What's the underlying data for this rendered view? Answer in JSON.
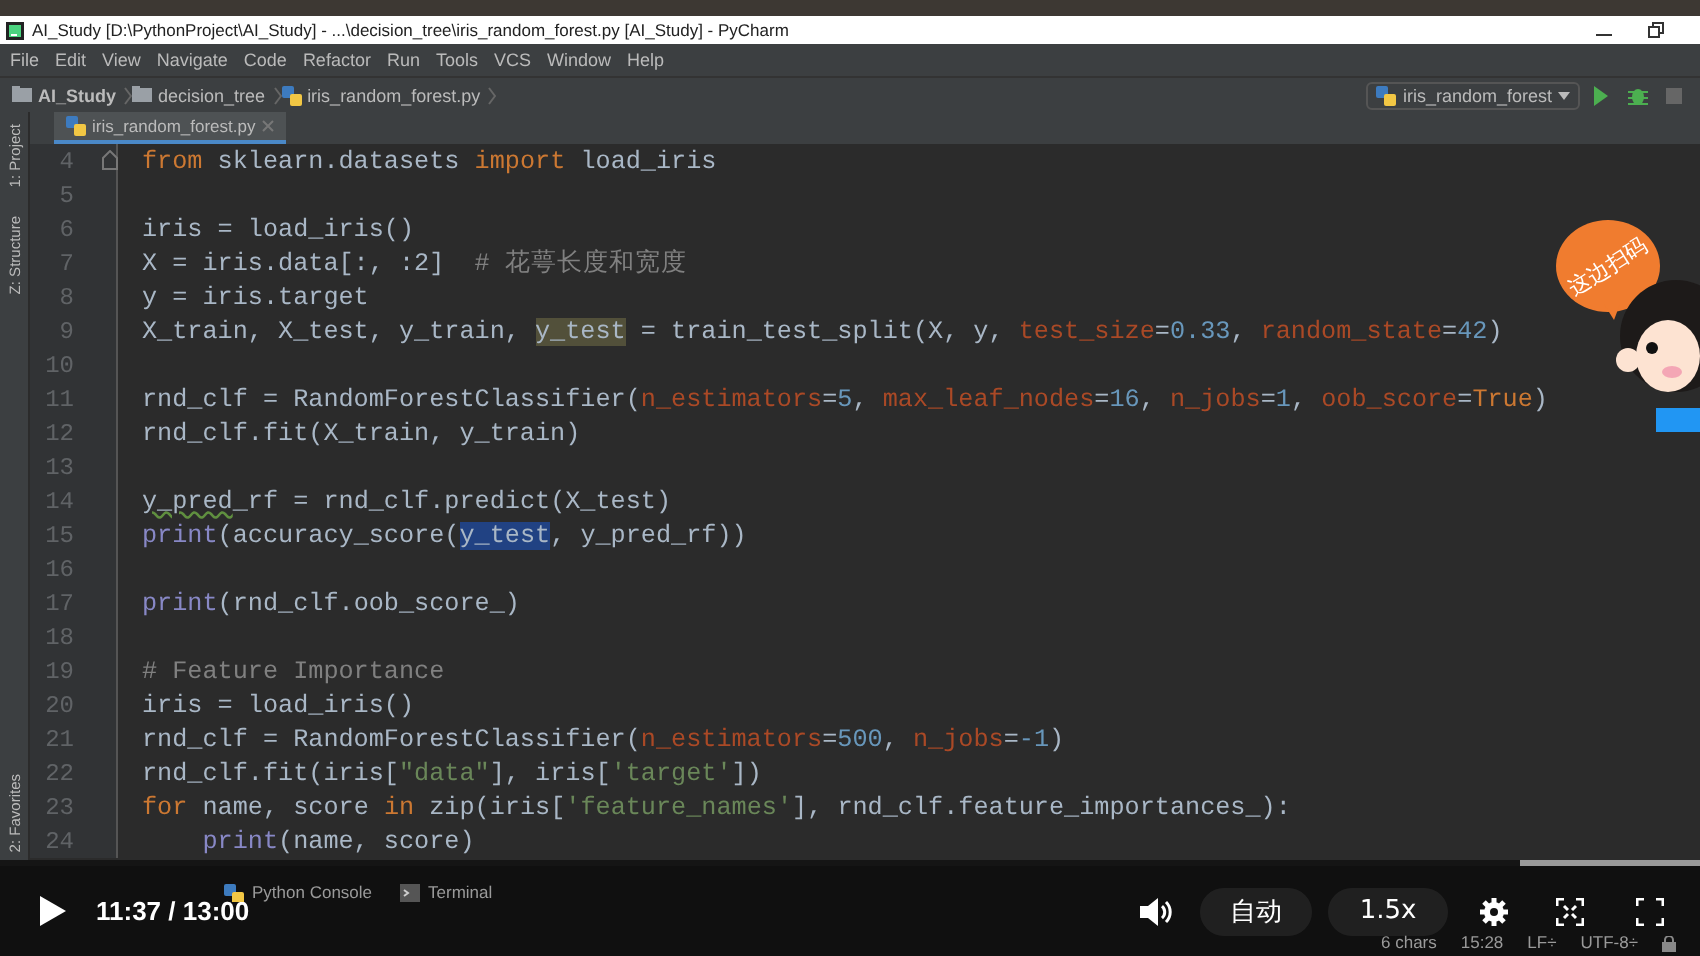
{
  "title_bar": {
    "title": "AI_Study [D:\\PythonProject\\AI_Study] - ...\\decision_tree\\iris_random_forest.py [AI_Study] - PyCharm"
  },
  "menu": [
    "File",
    "Edit",
    "View",
    "Navigate",
    "Code",
    "Refactor",
    "Run",
    "Tools",
    "VCS",
    "Window",
    "Help"
  ],
  "navigation_bar": {
    "breadcrumbs": [
      {
        "kind": "project",
        "label": "AI_Study"
      },
      {
        "kind": "folder",
        "label": "decision_tree"
      },
      {
        "kind": "file",
        "label": "iris_random_forest.py"
      }
    ],
    "run_configuration": "iris_random_forest"
  },
  "tool_window_stripe": {
    "top": [
      "1: Project",
      "Z: Structure"
    ],
    "bottom": [
      "2: Favorites"
    ]
  },
  "editor": {
    "tabs": [
      {
        "label": "iris_random_forest.py",
        "selected": true
      }
    ],
    "lines": [
      {
        "number": "4",
        "folded": true,
        "tokens": [
          {
            "kind": "keyword",
            "text": "from"
          },
          {
            "kind": "plain",
            "text": " sklearn.datasets "
          },
          {
            "kind": "keyword",
            "text": "import"
          },
          {
            "kind": "plain",
            "text": " load_iris"
          }
        ]
      },
      {
        "number": "5"
      },
      {
        "number": "6",
        "tokens": [
          {
            "kind": "plain",
            "text": "iris = load_iris()"
          }
        ]
      },
      {
        "number": "7",
        "tokens": [
          {
            "kind": "plain",
            "text": "X = iris.data[:, :2]  "
          },
          {
            "kind": "comment",
            "text": "# 花萼长度和宽度"
          }
        ]
      },
      {
        "number": "8",
        "tokens": [
          {
            "kind": "plain",
            "text": "y = iris.target"
          }
        ]
      },
      {
        "number": "9",
        "tokens": [
          {
            "kind": "plain",
            "text": "X_train, X_test, y_train, "
          },
          {
            "kind": "usage",
            "text": "y_test"
          },
          {
            "kind": "plain",
            "text": " = train_test_split(X, y, "
          },
          {
            "kind": "param",
            "text": "test_size"
          },
          {
            "kind": "plain",
            "text": "="
          },
          {
            "kind": "number",
            "text": "0.33"
          },
          {
            "kind": "plain",
            "text": ", "
          },
          {
            "kind": "param",
            "text": "random_state"
          },
          {
            "kind": "plain",
            "text": "="
          },
          {
            "kind": "number",
            "text": "42"
          },
          {
            "kind": "plain",
            "text": ")"
          }
        ]
      },
      {
        "number": "10"
      },
      {
        "number": "11",
        "tokens": [
          {
            "kind": "plain",
            "text": "rnd_clf = RandomForestClassifier("
          },
          {
            "kind": "param",
            "text": "n_estimators"
          },
          {
            "kind": "plain",
            "text": "="
          },
          {
            "kind": "number",
            "text": "5"
          },
          {
            "kind": "plain",
            "text": ", "
          },
          {
            "kind": "param",
            "text": "max_leaf_nodes"
          },
          {
            "kind": "plain",
            "text": "="
          },
          {
            "kind": "number",
            "text": "16"
          },
          {
            "kind": "plain",
            "text": ", "
          },
          {
            "kind": "param",
            "text": "n_jobs"
          },
          {
            "kind": "plain",
            "text": "="
          },
          {
            "kind": "number",
            "text": "1"
          },
          {
            "kind": "plain",
            "text": ", "
          },
          {
            "kind": "param",
            "text": "oob_score"
          },
          {
            "kind": "plain",
            "text": "="
          },
          {
            "kind": "keyword",
            "text": "True"
          },
          {
            "kind": "plain",
            "text": ")"
          }
        ]
      },
      {
        "number": "12",
        "tokens": [
          {
            "kind": "plain",
            "text": "rnd_clf.fit(X_train, y_train)"
          }
        ]
      },
      {
        "number": "13"
      },
      {
        "number": "14",
        "tokens": [
          {
            "kind": "typo",
            "text": "y_pred"
          },
          {
            "kind": "plain",
            "text": "_rf = rnd_clf.predict(X_test)"
          }
        ]
      },
      {
        "number": "15",
        "tokens": [
          {
            "kind": "builtin",
            "text": "print"
          },
          {
            "kind": "plain",
            "text": "(accuracy_score("
          },
          {
            "kind": "selected",
            "text": "y_test"
          },
          {
            "kind": "plain",
            "text": ", y_pred_rf))"
          }
        ]
      },
      {
        "number": "16"
      },
      {
        "number": "17",
        "tokens": [
          {
            "kind": "builtin",
            "text": "print"
          },
          {
            "kind": "plain",
            "text": "(rnd_clf.oob_score_)"
          }
        ]
      },
      {
        "number": "18"
      },
      {
        "number": "19",
        "tokens": [
          {
            "kind": "comment",
            "text": "# Feature Importance"
          }
        ]
      },
      {
        "number": "20",
        "tokens": [
          {
            "kind": "plain",
            "text": "iris = load_iris()"
          }
        ]
      },
      {
        "number": "21",
        "tokens": [
          {
            "kind": "plain",
            "text": "rnd_clf = RandomForestClassifier("
          },
          {
            "kind": "param",
            "text": "n_estimators"
          },
          {
            "kind": "plain",
            "text": "="
          },
          {
            "kind": "number",
            "text": "500"
          },
          {
            "kind": "plain",
            "text": ", "
          },
          {
            "kind": "param",
            "text": "n_jobs"
          },
          {
            "kind": "plain",
            "text": "="
          },
          {
            "kind": "number",
            "text": "-1"
          },
          {
            "kind": "plain",
            "text": ")"
          }
        ]
      },
      {
        "number": "22",
        "tokens": [
          {
            "kind": "plain",
            "text": "rnd_clf.fit(iris["
          },
          {
            "kind": "string",
            "text": "\"data\""
          },
          {
            "kind": "plain",
            "text": "], iris["
          },
          {
            "kind": "string",
            "text": "'target'"
          },
          {
            "kind": "plain",
            "text": "])"
          }
        ]
      },
      {
        "number": "23",
        "tokens": [
          {
            "kind": "keyword",
            "text": "for"
          },
          {
            "kind": "plain",
            "text": " name, score "
          },
          {
            "kind": "keyword",
            "text": "in"
          },
          {
            "kind": "plain",
            "text": " zip(iris["
          },
          {
            "kind": "string",
            "text": "'feature_names'"
          },
          {
            "kind": "plain",
            "text": "], rnd_clf.feature_importances_):"
          }
        ]
      },
      {
        "number": "24",
        "indented": true,
        "tokens": [
          {
            "kind": "builtin",
            "text": "print"
          },
          {
            "kind": "plain",
            "text": "(name, score)"
          }
        ]
      }
    ]
  },
  "bottom_tool_windows": [
    {
      "kind": "console",
      "label": "Python Console"
    },
    {
      "kind": "terminal",
      "label": "Terminal"
    }
  ],
  "status_bar": [
    "6 chars",
    "15:28",
    "LF÷",
    "UTF-8÷"
  ],
  "video_player": {
    "progress": {
      "level": 0.894
    },
    "time": "11:37 / 13:00",
    "quality": "自动",
    "speed": "1.5x"
  },
  "promo_bubble": {
    "text": "这边扫码"
  }
}
